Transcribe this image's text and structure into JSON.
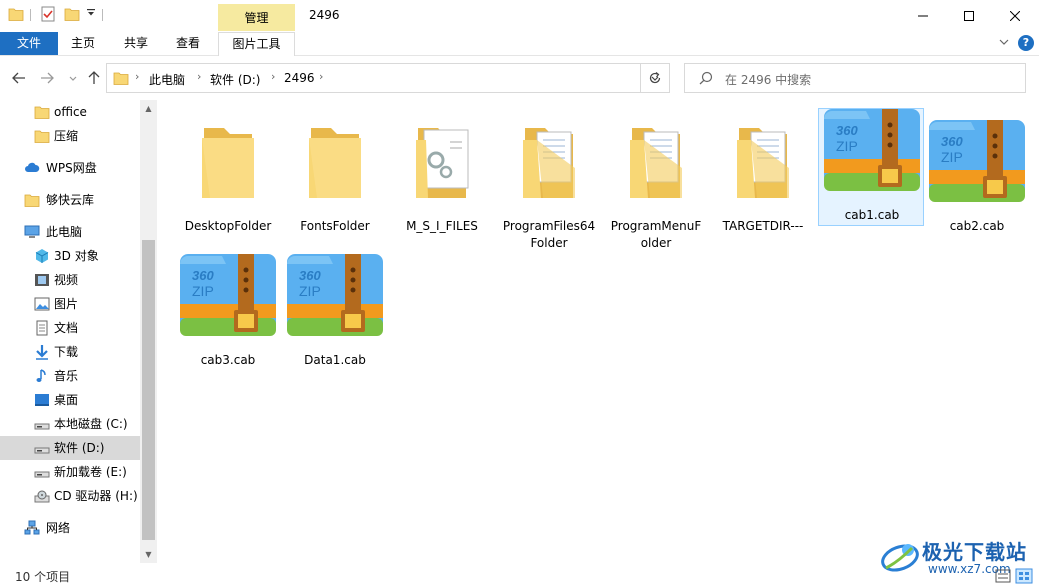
{
  "titlebar": {
    "context_tab": "管理",
    "title": "2496"
  },
  "ribbon": {
    "tabs": [
      "文件",
      "主页",
      "共享",
      "查看",
      "图片工具"
    ],
    "help": "?"
  },
  "address": {
    "crumbs": [
      "此电脑",
      "软件 (D:)",
      "2496"
    ]
  },
  "search": {
    "placeholder": "在 2496 中搜索"
  },
  "sidebar": {
    "items": [
      {
        "label": "office",
        "icon": "folder-icon"
      },
      {
        "label": "压缩",
        "icon": "folder-icon"
      },
      {
        "label": "WPS网盘",
        "icon": "cloud-icon"
      },
      {
        "label": "够快云库",
        "icon": "folder-icon"
      },
      {
        "label": "此电脑",
        "icon": "computer-icon"
      },
      {
        "label": "3D 对象",
        "icon": "cube-icon"
      },
      {
        "label": "视频",
        "icon": "video-icon"
      },
      {
        "label": "图片",
        "icon": "picture-icon"
      },
      {
        "label": "文档",
        "icon": "document-icon"
      },
      {
        "label": "下载",
        "icon": "download-icon"
      },
      {
        "label": "音乐",
        "icon": "music-icon"
      },
      {
        "label": "桌面",
        "icon": "desktop-icon"
      },
      {
        "label": "本地磁盘 (C:)",
        "icon": "drive-icon"
      },
      {
        "label": "软件 (D:)",
        "icon": "drive-icon"
      },
      {
        "label": "新加载卷 (E:)",
        "icon": "drive-icon"
      },
      {
        "label": "CD 驱动器 (H:)",
        "icon": "cd-icon"
      },
      {
        "label": "网络",
        "icon": "network-icon"
      }
    ],
    "selected": "软件 (D:)"
  },
  "files": [
    {
      "name": "DesktopFolder",
      "type": "folder"
    },
    {
      "name": "FontsFolder",
      "type": "folder"
    },
    {
      "name": "M_S_I_FILES",
      "type": "folder-docs"
    },
    {
      "name": "ProgramFiles64\nFolder",
      "type": "folder-docs"
    },
    {
      "name": "ProgramMenuF\nolder",
      "type": "folder-docs"
    },
    {
      "name": "TARGETDIR---",
      "type": "folder-docs"
    },
    {
      "name": "cab1.cab",
      "type": "zip"
    },
    {
      "name": "cab2.cab",
      "type": "zip"
    },
    {
      "name": "cab3.cab",
      "type": "zip"
    },
    {
      "name": "Data1.cab",
      "type": "zip"
    }
  ],
  "status": {
    "text": "10 个项目"
  },
  "watermark": {
    "title": "极光下载站",
    "url": "www.xz7.com"
  },
  "colors": {
    "accent": "#1e6fc2",
    "context_tab": "#f6eaa0",
    "selection": "#cce8ff",
    "folder": "#f8d775"
  }
}
